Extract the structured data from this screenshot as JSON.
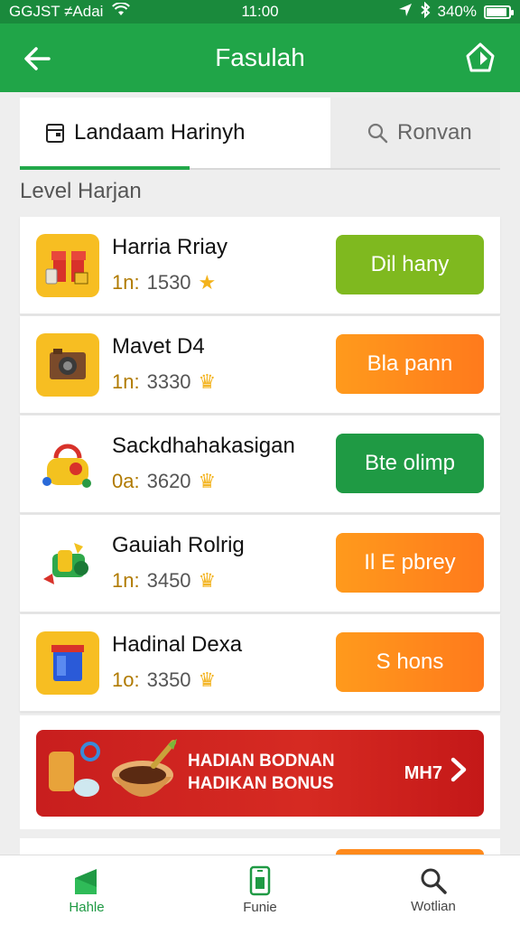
{
  "status_bar": {
    "carrier": "GGJST ≠Adai",
    "time": "11:00",
    "battery": "340%"
  },
  "header": {
    "title": "Fasulah"
  },
  "tabs": [
    {
      "label": "Landaam Harinyh",
      "active": true
    },
    {
      "label": "Ronvan",
      "active": false
    }
  ],
  "section_title": "Level Harjan",
  "items": [
    {
      "name": "Harria Rriay",
      "prefix": "1n:",
      "points": "1530",
      "button": "Dil hany",
      "button_color": "#7fb91f",
      "icon": "red-gift-box-icon"
    },
    {
      "name": "Mavet D4",
      "prefix": "1n:",
      "points": "3330",
      "button": "Bla pann",
      "button_color": "#ff8a1c",
      "icon": "brown-camera-icon"
    },
    {
      "name": "Sackdhahakasigan",
      "prefix": "0a:",
      "points": "3620",
      "button": "Bte olimp",
      "button_color": "#1f9a44",
      "icon": "toy-purse-icon"
    },
    {
      "name": "Gauiah Rolrig",
      "prefix": "1n:",
      "points": "3450",
      "button": "Il E pbrey",
      "button_color": "#ff8a1c",
      "icon": "toy-gadget-icon"
    },
    {
      "name": "Hadinal Dexa",
      "prefix": "1o:",
      "points": "3350",
      "button": "S hons",
      "button_color": "#ff8a1c",
      "icon": "blue-box-icon"
    }
  ],
  "banner": {
    "line1": "HADIAN BODNAN",
    "line2": "HADIKAN BONUS",
    "cta": "MH7"
  },
  "bottom_nav": [
    {
      "label": "Hahle",
      "icon": "home-flag-icon",
      "active": true
    },
    {
      "label": "Funie",
      "icon": "phone-icon",
      "active": false
    },
    {
      "label": "Wotlian",
      "icon": "search-icon",
      "active": false
    }
  ]
}
